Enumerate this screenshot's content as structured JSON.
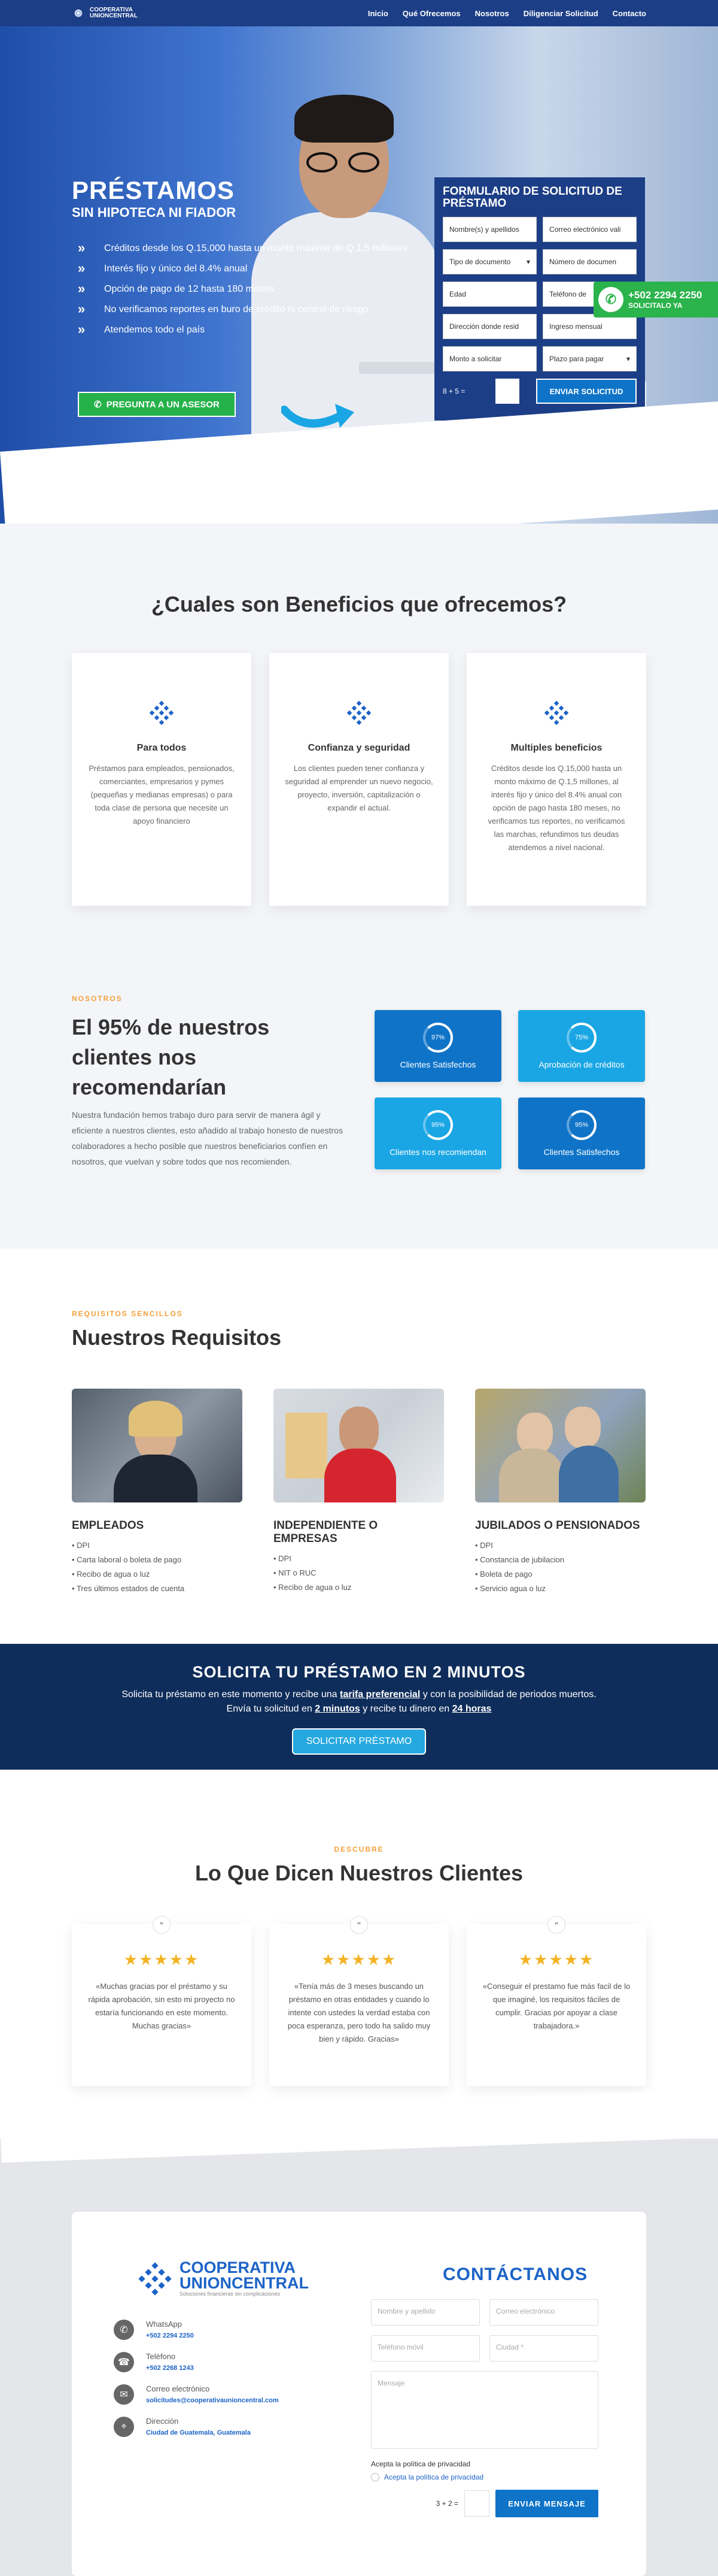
{
  "nav": {
    "logo_line1": "COOPERATIVA",
    "logo_line2": "UNIONCENTRAL",
    "links": [
      "Inicio",
      "Qué Ofrecemos",
      "Nosotros",
      "Diligenciar Solicitud",
      "Contacto"
    ]
  },
  "hero": {
    "title": "PRÉSTAMOS",
    "subtitle": "SIN HIPOTECA NI FIADOR",
    "bullets": [
      "Créditos desde los Q.15,000 hasta un monto máximo de Q.1,5 millones",
      "Interés fijo y único del 8.4% anual",
      "Opción de pago de 12 hasta 180 meses",
      "No verificamos reportes en buro de crédito ni central de riesgo",
      "Atendemos todo el país"
    ],
    "advisor_button": "PREGUNTA A UN ASESOR"
  },
  "loan_form": {
    "title": "FORMULARIO DE SOLICITUD DE PRÉSTAMO",
    "fields": [
      "Nombre(s) y apellidos",
      "Correo electrónico vali",
      "Tipo de documento",
      "Número de documen",
      "Edad",
      "Teléfono de",
      "Dirección donde resid",
      "Ingreso mensual",
      "Monto a solicitar",
      "Plazo para pagar"
    ],
    "captcha": "8 + 5 =",
    "submit": "ENVIAR SOLICITUD"
  },
  "whatsapp": {
    "number": "+502 2294 2250",
    "label": "SOLICITALO YA"
  },
  "benefits": {
    "title": "¿Cuales son Beneficios que ofrecemos?",
    "cards": [
      {
        "title": "Para todos",
        "text": "Préstamos para empleados, pensionados, comerciantes, empresarios y pymes (pequeñas y medianas empresas) o para toda clase de persona que necesite un apoyo financiero"
      },
      {
        "title": "Confianza y seguridad",
        "text": "Los clientes pueden tener confianza y seguridad al emprender un nuevo negocio, proyecto, inversión, capitalización o expandir el actual."
      },
      {
        "title": "Multiples beneficios",
        "text": "Créditos desde los Q.15,000 hasta un monto máximo de Q.1,5 millones, al interés fijo y único del 8.4% anual con opción de pago hasta 180 meses, no verificamos tus reportes, no verificamos las marchas, refundimos tus deudas atendemos a nivel nacional."
      }
    ]
  },
  "stats": {
    "overline": "NOSOTROS",
    "title": "El 95% de nuestros clientes nos recomendarían",
    "text": "Nuestra fundación hemos trabajo duro para servir de manera ágil y eficiente a nuestros clientes, esto añadido al trabajo honesto de nuestros colaboradores a hecho posible que nuestros beneficiarios confíen en nosotros, que vuelvan y sobre todos que nos recomienden.",
    "tiles": [
      {
        "value": "97%",
        "label": "Clientes Satisfechos",
        "color": "#0f74c8"
      },
      {
        "value": "75%",
        "label": "Aprobación de créditos",
        "color": "#1aa6e4"
      },
      {
        "value": "95%",
        "label": "Clientes nos recomiendan",
        "color": "#1aa6e4"
      },
      {
        "value": "95%",
        "label": "Clientes Satisfechos",
        "color": "#0f74c8"
      }
    ]
  },
  "requirements": {
    "overline": "REQUISITOS SENCILLOS",
    "title": "Nuestros Requisitos",
    "columns": [
      {
        "title": "EMPLEADOS",
        "items": [
          "DPI",
          "Carta laboral o boleta de pago",
          "Recibo de agua o luz",
          "Tres últimos estados de cuenta"
        ]
      },
      {
        "title": "INDEPENDIENTE O EMPRESAS",
        "items": [
          "DPI",
          "NIT o RUC",
          "Recibo de agua o luz"
        ]
      },
      {
        "title": "JUBILADOS O PENSIONADOS",
        "items": [
          "DPI",
          "Constancia de jubilacion",
          "Boleta de pago",
          "Servicio agua o luz"
        ]
      }
    ]
  },
  "cta": {
    "title": "SOLICITA TU PRÉSTAMO EN 2 MINUTOS",
    "line1_a": "Solicita tu préstamo en este momento y recibe una ",
    "line1_b": "tarifa preferencial",
    "line1_c": " y con la posibilidad de periodos muertos.",
    "line2_a": "Envía tu solicitud en ",
    "line2_b": "2 minutos",
    "line2_c": " y recibe tu dinero en ",
    "line2_d": "24 horas",
    "button": "SOLICITAR PRÉSTAMO"
  },
  "testimonials": {
    "overline": "DESCUBRE",
    "title": "Lo Que Dicen Nuestros Clientes",
    "stars": "★★★★★",
    "quotes": [
      "«Muchas gracias por el préstamo y su rápida aprobación, sin esto mi proyecto no estaría funcionando en este momento. Muchas gracias»",
      "«Tenía más de 3 meses buscando un préstamo en otras entidades y cuando lo intente con ustedes la verdad estaba con poca esperanza, pero todo ha salido muy bien y rápido. Gracias»",
      "«Conseguir el prestamo fue más facil de lo que imaginé, los requisitos fáciles de cumplir. Gracias por apoyar a clase trabajadora.»"
    ]
  },
  "contact": {
    "logo_line1": "COOPERATIVA",
    "logo_line2": "UNIONCENTRAL",
    "logo_tagline": "Soluciones financieras sin complicaciones",
    "items": [
      {
        "label": "WhatsApp",
        "value": "+502 2294 2250"
      },
      {
        "label": "Teléfono",
        "value": "+502 2268 1243"
      },
      {
        "label": "Correo electrónico",
        "value": "solicitudes@cooperativaunioncentral.com"
      },
      {
        "label": "Dirección",
        "value": "Ciudad de Guatemala, Guatemala"
      }
    ],
    "title": "CONTÁCTANOS",
    "placeholders": [
      "Nombre y apellido",
      "Correo electrónico",
      "Teléfono móvil",
      "Ciudad *",
      "Mensaje"
    ],
    "privacy_label": "Acepta la política de privacidad",
    "privacy_option": "Acepta la política de privacidad",
    "captcha": "3 + 2 =",
    "submit": "ENVIAR MENSAJE"
  }
}
